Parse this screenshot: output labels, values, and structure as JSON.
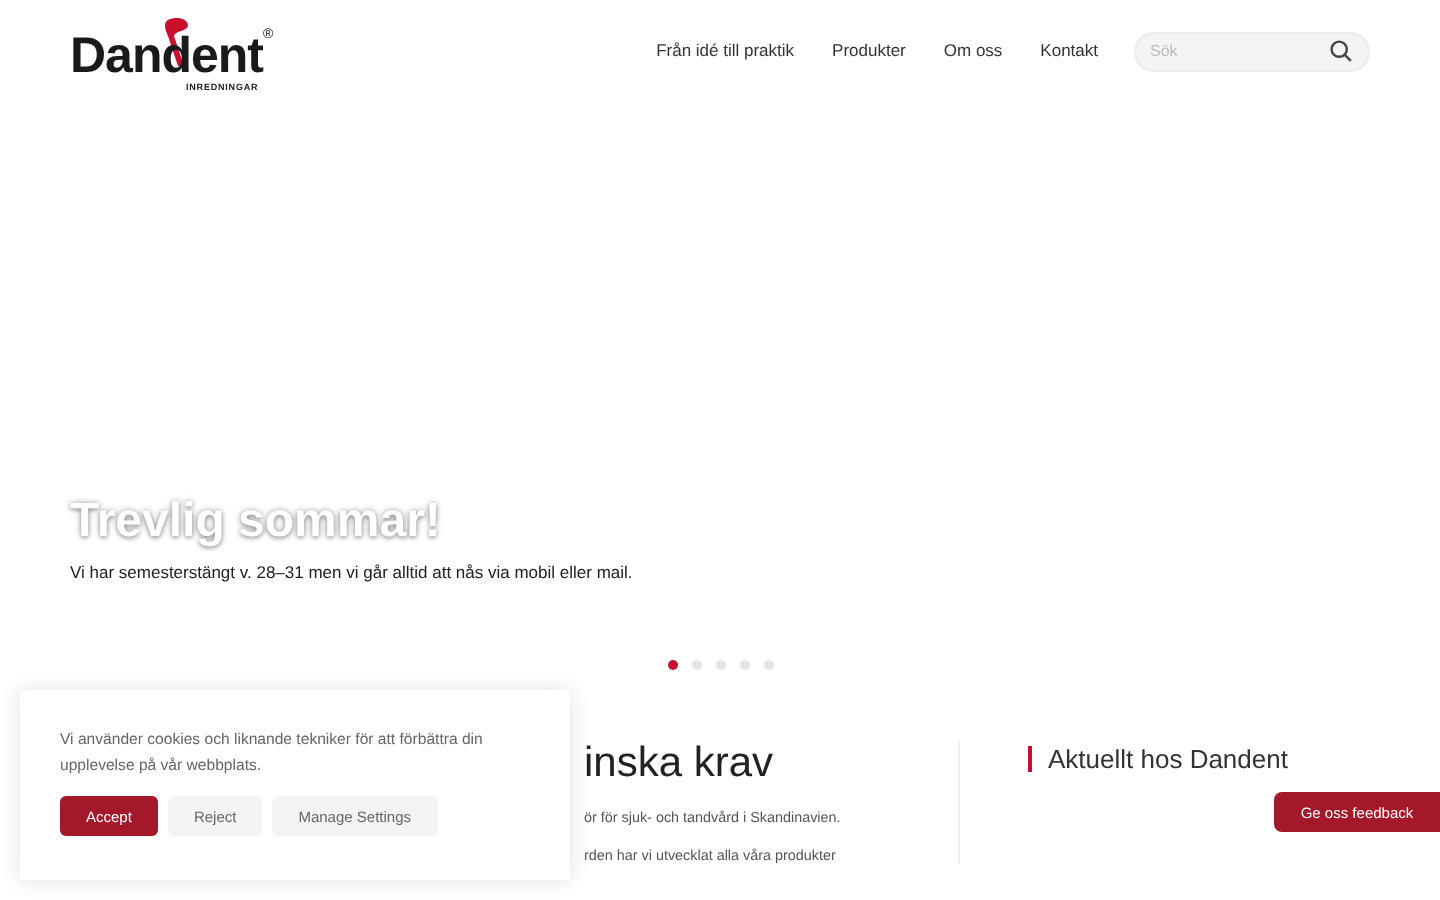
{
  "logo": {
    "name": "Dandent",
    "tagline": "INREDNINGAR",
    "mark": "®"
  },
  "nav": [
    {
      "label": "Från idé till praktik"
    },
    {
      "label": "Produkter"
    },
    {
      "label": "Om oss"
    },
    {
      "label": "Kontakt"
    }
  ],
  "search": {
    "placeholder": "Sök"
  },
  "hero": {
    "title": "Trevlig sommar!",
    "text": "Vi har semesterstängt v. 28–31 men vi går alltid att nås via mobil eller mail.",
    "slides": [
      {
        "selected": true
      },
      {
        "selected": false
      },
      {
        "selected": false
      },
      {
        "selected": false
      },
      {
        "selected": false
      }
    ]
  },
  "main": {
    "heading": "inska krav",
    "lines": [
      "ör för sjuk- och tandvård i Skandinavien.",
      "rden har vi utvecklat alla våra produkter"
    ]
  },
  "news": {
    "heading": "Aktuellt hos Dandent"
  },
  "cookie": {
    "text": "Vi använder cookies och liknande tekniker för att förbättra din upplevelse på vår webbplats.",
    "buttons": [
      {
        "label": "Accept",
        "kind": "primary"
      },
      {
        "label": "Reject",
        "kind": "secondary"
      },
      {
        "label": "Manage Settings",
        "kind": "secondary"
      }
    ]
  },
  "feedback": {
    "label": "Ge oss feedback"
  }
}
